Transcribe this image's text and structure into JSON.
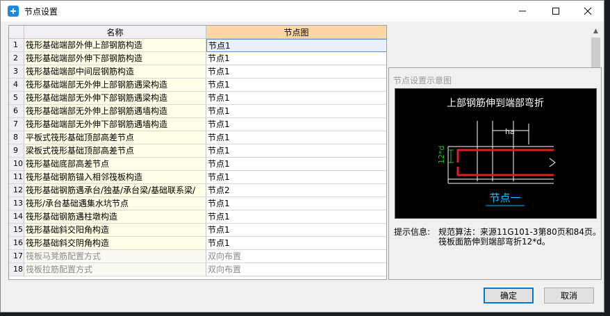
{
  "window": {
    "title": "节点设置"
  },
  "grid": {
    "columns": [
      "名称",
      "节点图"
    ],
    "rows": [
      {
        "num": "1",
        "name": "筏形基础端部外伸上部钢筋构造",
        "value": "节点1"
      },
      {
        "num": "2",
        "name": "筏形基础端部外伸下部钢筋构造",
        "value": "节点1"
      },
      {
        "num": "3",
        "name": "筏形基础端部中间层钢筋构造",
        "value": "节点1"
      },
      {
        "num": "4",
        "name": "筏形基础端部无外伸上部钢筋遇梁构造",
        "value": "节点1"
      },
      {
        "num": "5",
        "name": "筏形基础端部无外伸下部钢筋遇梁构造",
        "value": "节点1"
      },
      {
        "num": "6",
        "name": "筏形基础端部无外伸上部钢筋遇墙构造",
        "value": "节点1"
      },
      {
        "num": "7",
        "name": "筏形基础端部无外伸下部钢筋遇墙构造",
        "value": "节点1"
      },
      {
        "num": "8",
        "name": "平板式筏形基础顶部高差节点",
        "value": "节点1"
      },
      {
        "num": "9",
        "name": "梁板式筏形基础顶部高差节点",
        "value": "节点1"
      },
      {
        "num": "10",
        "name": "筏形基础底部高差节点",
        "value": "节点1"
      },
      {
        "num": "11",
        "name": "筏形基础钢筋锚入相邻筏板构造",
        "value": "节点1"
      },
      {
        "num": "12",
        "name": "筏形基础钢筋遇承台/独基/承台梁/基础联系梁/",
        "value": "节点2"
      },
      {
        "num": "13",
        "name": "筏形/承台基础遇集水坑节点",
        "value": "节点1"
      },
      {
        "num": "14",
        "name": "筏形基础钢筋遇柱墩构造",
        "value": "节点1"
      },
      {
        "num": "15",
        "name": "筏形基础斜交阳角构造",
        "value": "节点1"
      },
      {
        "num": "16",
        "name": "筏形基础斜交阴角构造",
        "value": "节点1"
      },
      {
        "num": "17",
        "name": "筏板马凳筋配置方式",
        "value": "双向布置"
      },
      {
        "num": "18",
        "name": "筏板拉筋配置方式",
        "value": "双向布置"
      }
    ]
  },
  "preview": {
    "title": "节点设置示意图",
    "diagram_title": "上部钢筋伸到端部弯折",
    "dim_ha": "ha",
    "dim_12d": "12*d",
    "node_label": "节点一",
    "hint_label": "提示信息:",
    "hint_line1": "规范算法：来源11G101-3第80页和84页。",
    "hint_line2": "筏板面筋伸到端部弯折12*d。"
  },
  "buttons": {
    "ok": "确定",
    "cancel": "取消"
  },
  "colors": {
    "header_accent": "#fbd7a4",
    "rebar": "#e02020",
    "dimension": "#20c020",
    "node_label": "#00c8ff"
  }
}
